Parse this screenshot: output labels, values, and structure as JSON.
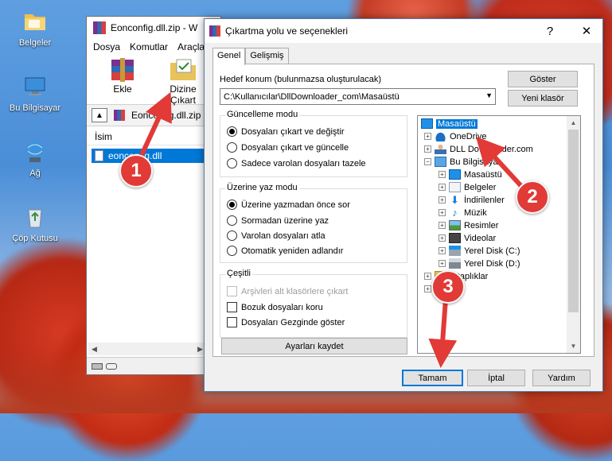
{
  "desktop": {
    "icons": [
      {
        "label": "Belgeler",
        "icon": "folder-icon"
      },
      {
        "label": "Bu Bilgisayar",
        "icon": "computer-icon"
      },
      {
        "label": "Ağ",
        "icon": "network-icon"
      },
      {
        "label": "Çöp Kutusu",
        "icon": "recycle-bin-icon"
      }
    ]
  },
  "winrar": {
    "title": "Eonconfig.dll.zip - W",
    "menu": [
      "Dosya",
      "Komutlar",
      "Araçla"
    ],
    "toolbar": {
      "add": "Ekle",
      "extract_to": "Dizine Çıkart"
    },
    "address": "Eonconfig.dll.zip",
    "list_header": "İsim",
    "file": "eonconfig.dll"
  },
  "dialog": {
    "title": "Çıkartma yolu ve seçenekleri",
    "help_btn": "?",
    "close_btn": "✕",
    "tabs": [
      "Genel",
      "Gelişmiş"
    ],
    "dest_label": "Hedef konum (bulunmazsa oluşturulacak)",
    "dest_value": "C:\\Kullanıcılar\\DllDownloader_com\\Masaüstü",
    "show_btn": "Göster",
    "new_folder_btn": "Yeni klasör",
    "update_mode": {
      "title": "Güncelleme modu",
      "options": [
        "Dosyaları çıkart ve değiştir",
        "Dosyaları çıkart ve güncelle",
        "Sadece varolan dosyaları tazele"
      ],
      "selected": 0
    },
    "overwrite_mode": {
      "title": "Üzerine yaz modu",
      "options": [
        "Üzerine yazmadan önce sor",
        "Sormadan üzerine yaz",
        "Varolan dosyaları atla",
        "Otomatik yeniden adlandır"
      ],
      "selected": 0
    },
    "misc": {
      "title": "Çeşitli",
      "options": [
        "Arşivleri alt klasörlere çıkart",
        "Bozuk dosyaları koru",
        "Dosyaları Gezginde göster"
      ]
    },
    "save_settings_btn": "Ayarları kaydet",
    "tree": [
      {
        "label": "Masaüstü",
        "icon": "desktop-icon"
      },
      {
        "label": "OneDrive",
        "icon": "cloud-icon"
      },
      {
        "label": "DLL Downloader.com",
        "icon": "user-icon"
      },
      {
        "label": "Bu Bilgisayar",
        "icon": "computer-icon"
      },
      {
        "label": "Masaüstü",
        "icon": "desktop-icon"
      },
      {
        "label": "Belgeler",
        "icon": "documents-icon"
      },
      {
        "label": "İndirilenler",
        "icon": "download-icon"
      },
      {
        "label": "Müzik",
        "icon": "music-icon"
      },
      {
        "label": "Resimler",
        "icon": "pictures-icon"
      },
      {
        "label": "Videolar",
        "icon": "video-icon"
      },
      {
        "label": "Yerel Disk (C:)",
        "icon": "drive-icon"
      },
      {
        "label": "Yerel Disk (D:)",
        "icon": "drive-icon"
      },
      {
        "label": "Kitaplıklar",
        "icon": "library-icon"
      },
      {
        "label": "Ağ",
        "icon": "network-icon"
      }
    ],
    "ok_btn": "Tamam",
    "cancel_btn": "İptal",
    "help_text_btn": "Yardım"
  },
  "annotations": {
    "step1": "1",
    "step2": "2",
    "step3": "3"
  },
  "colors": {
    "accent": "#0078d7",
    "badge": "#e13a37"
  }
}
